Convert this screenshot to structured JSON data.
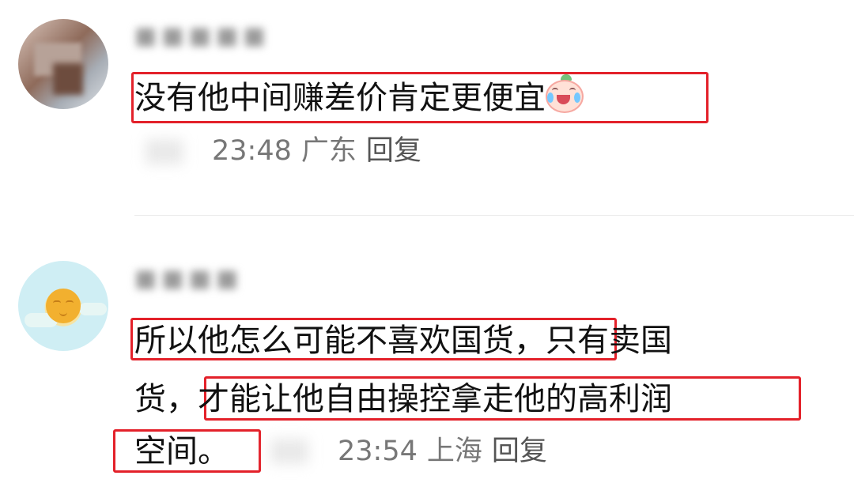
{
  "comments": [
    {
      "username": "■■■■■",
      "text": "没有他中间赚差价肯定更便宜",
      "emoji": "crying-laughing-face-icon",
      "time": "23:48",
      "location": "广东",
      "reply_label": "回复"
    },
    {
      "username": "■■■■",
      "line1_highlight": "所以他怎么可能不喜欢国货",
      "line1_tail": "，只有卖国",
      "line2_head": "货，",
      "line2_highlight": "才能让他自由操控拿走他的高利润",
      "line3_highlight": "空间。",
      "time": "23:54",
      "location": "上海",
      "reply_label": "回复"
    }
  ],
  "colors": {
    "highlight_box": "#e3212a",
    "meta_text": "#777777",
    "body_text": "#111111"
  }
}
